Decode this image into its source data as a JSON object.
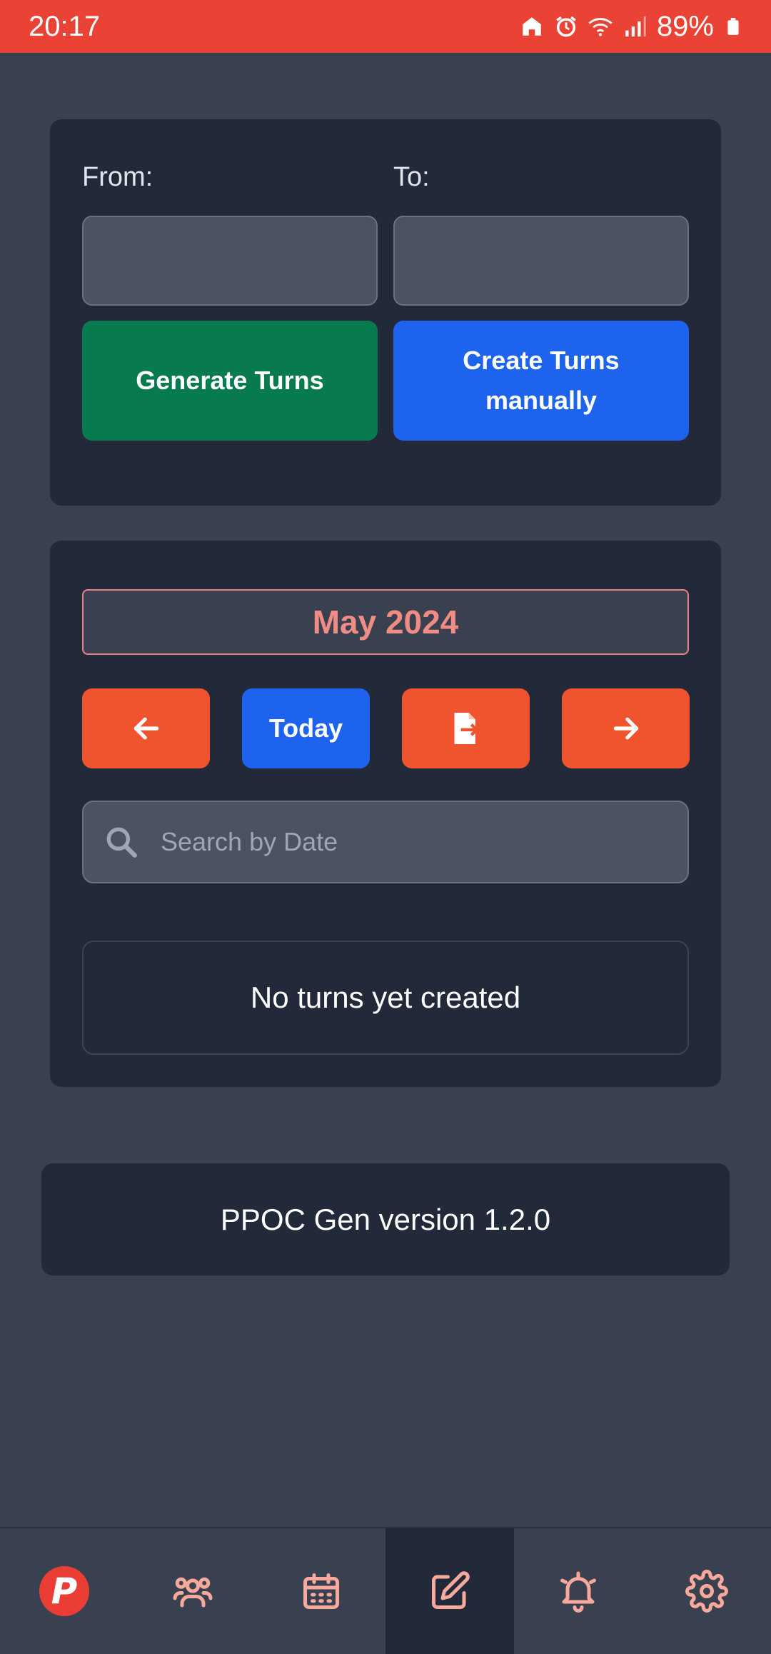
{
  "status_bar": {
    "time": "20:17",
    "battery": "89%",
    "icons": [
      "home-icon",
      "alarm-icon",
      "wifi-icon",
      "signal-icon",
      "battery-icon"
    ]
  },
  "generator": {
    "from_label": "From:",
    "to_label": "To:",
    "from_value": "",
    "to_value": "",
    "generate_button": "Generate Turns",
    "create_manual_button_line1": "Create Turns",
    "create_manual_button_line2": "manually"
  },
  "calendar": {
    "month_title": "May 2024",
    "prev_icon": "arrow-left-icon",
    "today_button": "Today",
    "export_icon": "file-export-icon",
    "next_icon": "arrow-right-icon",
    "search_placeholder": "Search by Date",
    "empty_message": "No turns yet created"
  },
  "footer": {
    "version_text": "PPOC Gen version 1.2.0"
  },
  "bottom_nav": {
    "items": [
      "app-logo",
      "users-icon",
      "calendar-icon",
      "edit-icon",
      "bell-icon",
      "gear-icon"
    ],
    "active": "edit-icon",
    "logo_letter": "P"
  },
  "colors": {
    "status_bar": "#ea4335",
    "background": "#394150",
    "card": "#222938",
    "green": "#077a4e",
    "blue": "#1e63ee",
    "orange": "#f0542f",
    "accent_text": "#f08c84",
    "nav_icon": "#f7a99c"
  }
}
